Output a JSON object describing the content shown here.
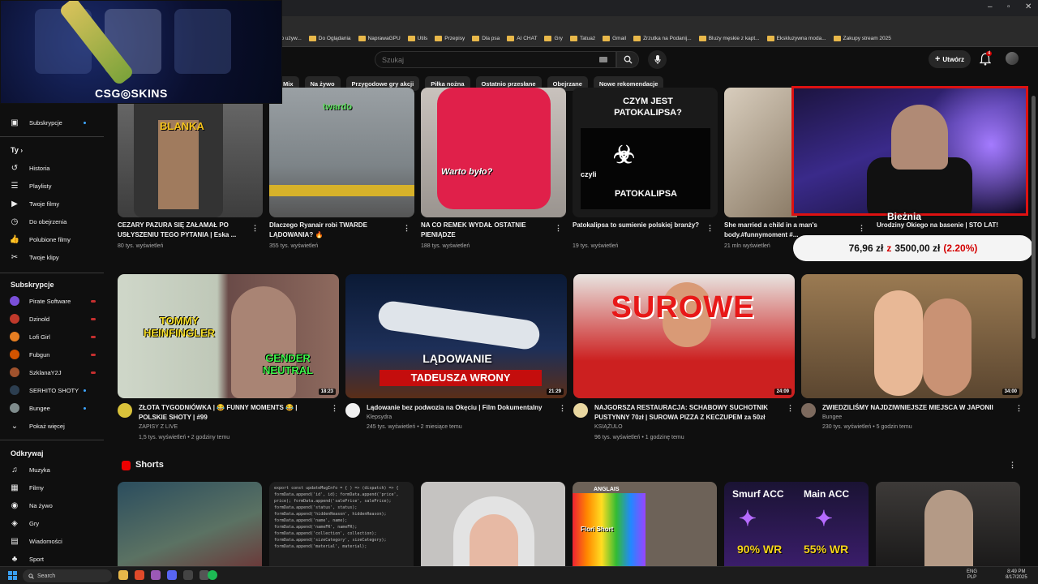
{
  "window": {
    "minimize": "–",
    "maximize": "▫",
    "close": "✕"
  },
  "bookmarks": [
    "Do Oglądania",
    "NaprawaGPU",
    "Utils",
    "Przepisy",
    "Dla psa",
    "AI CHAT",
    "Gry",
    "Tatuaż",
    "Gmail",
    "Zrzutka na Podanij...",
    "Bluzy męskie z kapt...",
    "Ekskluzywna moda...",
    "Zakupy stream 2025"
  ],
  "bookmark_prefix": "lelo używ...",
  "header": {
    "search_placeholder": "Szukaj",
    "create_label": "Utwórz",
    "notif_count": "4"
  },
  "chips": [
    "Mix",
    "Na żywo",
    "Przygodowe gry akcji",
    "Piłka nożna",
    "Ostatnio przesłane",
    "Obejrzane",
    "Nowe rekomendacje"
  ],
  "sidebar": {
    "subs_label": "Subskrypcje",
    "you_label": "Ty",
    "you_items": [
      "Historia",
      "Playlisty",
      "Twoje filmy",
      "Do obejrzenia",
      "Polubione filmy",
      "Twoje klipy"
    ],
    "subscriptions_header": "Subskrypcje",
    "channels": [
      "Pirate Software",
      "Dzinold",
      "Lofi Girl",
      "Fubgun",
      "SzklanaY2J",
      "SERHITO SHOTY",
      "Bungee"
    ],
    "show_more": "Pokaż więcej",
    "explore_header": "Odkrywaj",
    "explore_items": [
      "Muzyka",
      "Filmy",
      "Na żywo",
      "Gry",
      "Wiadomości",
      "Sport"
    ]
  },
  "overlay": {
    "logo": "CSG◎SKINS"
  },
  "row1": [
    {
      "title": "CEZARY PAZURA SIĘ ZAŁAMAŁ PO USŁYSZENIU TEGO PYTANIA | Eska ...",
      "views": "80 tys. wyświetleń",
      "thumb_text": "BLANKA"
    },
    {
      "title": "Dlaczego Ryanair robi TWARDE LĄDOWANIA? 🔥",
      "views": "355 tys. wyświetleń",
      "thumb_text": "twardo"
    },
    {
      "title": "NA CO REMEK WYDAŁ OSTATNIE PIENIĄDZE",
      "views": "188 tys. wyświetleń",
      "thumb_text": "Warto było?"
    },
    {
      "title": "Patokalipsa to sumienie polskiej branży?",
      "views": "19 tys. wyświetleń",
      "thumb_text": "CZYM JEST PATOKALIPSA?",
      "thumb_text2": "PATOKALIPSA",
      "thumb_text3": "czyli"
    },
    {
      "title": "She married a child in a man's body.#funnymoment #...",
      "views": "21 mln wyświetleń"
    },
    {
      "title": "Urodziny Okiego na basenie | STO LAT!",
      "views": ""
    }
  ],
  "cam": {
    "label": "Bieżnia"
  },
  "price_bar": {
    "amount": "76,96 zł",
    "sep": "z",
    "goal": "3500,00 zł",
    "pct": "(2.20%)"
  },
  "row2": [
    {
      "title": "ZŁOTA TYGODNIÓWKA | 😂 FUNNY MOMENTS 😂 | POLSKIE SHOTY | #99",
      "channel": "ZAPISY Z LIVE",
      "meta": "1,5 tys. wyświetleń • 2 godziny temu",
      "duration": "18:23",
      "thumb_text": "TOMMY HEINFINGLER",
      "thumb_text2": "GENDER NEUTRAL"
    },
    {
      "title": "Lądowanie bez podwozia na Okęciu | Film Dokumentalny",
      "channel": "Klepsydra",
      "meta": "245 tys. wyświetleń • 2 miesiące temu",
      "duration": "21:29",
      "thumb_text": "LĄDOWANIE",
      "thumb_text2": "TADEUSZA WRONY"
    },
    {
      "title": "NAJGORSZA RESTAURACJA: SCHABOWY SUCHOTNIK PUSTYNNY 70zł | SUROWA PIZZA Z KECZUPEM za 50zł",
      "channel": "KSIĄŻULO",
      "meta": "96 tys. wyświetleń • 1 godzinę temu",
      "duration": "24:09",
      "thumb_text": "SUROWE"
    },
    {
      "title": "ZWIEDZILIŚMY NAJDZIWNIEJSZE MIEJSCA W JAPONII",
      "channel": "Bungee",
      "meta": "230 tys. wyświetleń • 5 godzin temu",
      "duration": "34:00"
    }
  ],
  "shorts": {
    "title": "Shorts",
    "items": [
      {
        "text": ""
      },
      {
        "text": "export const updateMugInfo = { ) => (dispatch) => {  formData.append('id', id);  formData.append('price', price);  formData.append('salePrice', salePrice);  formData.append('status', status);  formData.append('hiddenReason', hiddenReason);  formData.append('name', name);  formData.append('nameFR', nameFR);  formData.append('collection', collection);  formData.append('sizeCategory', sizeCategory);  formData.append('material', material);"
      },
      {
        "text": ""
      },
      {
        "text": "Flori Short",
        "sign": "ANGLAIS"
      },
      {
        "text": "Smurf ACC",
        "text2": "Main ACC",
        "text3": "90% WR",
        "text4": "55% WR"
      },
      {
        "text": ""
      }
    ]
  },
  "taskbar": {
    "search": "Search",
    "lang": "ENG",
    "lang2": "PLP",
    "time": "8:49 PM",
    "date": "8/17/2025"
  },
  "colors": {
    "bg": "#0f0f0f",
    "accent_red": "#ff0000",
    "chip_bg": "#272727"
  }
}
